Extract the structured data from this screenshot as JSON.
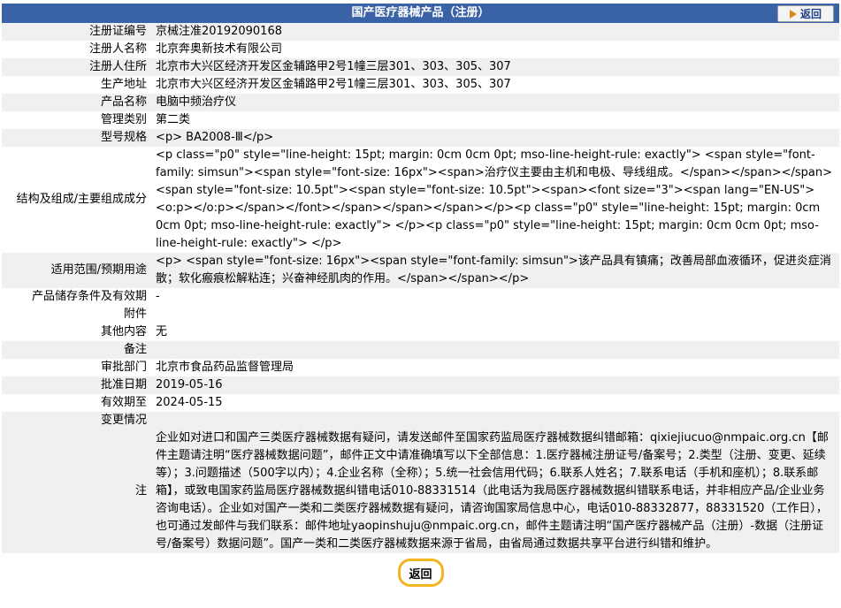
{
  "header": {
    "title": "国产医疗器械产品（注册）",
    "back_label": "返回"
  },
  "rows": [
    {
      "label": "注册证编号",
      "value": "京械注准20192090168"
    },
    {
      "label": "注册人名称",
      "value": "北京奔奥新技术有限公司"
    },
    {
      "label": "注册人住所",
      "value": "北京市大兴区经济开发区金辅路甲2号1幢三层301、303、305、307"
    },
    {
      "label": "生产地址",
      "value": "北京市大兴区经济开发区金辅路甲2号1幢三层301、303、305、307"
    },
    {
      "label": "产品名称",
      "value": "电脑中频治疗仪"
    },
    {
      "label": "管理类别",
      "value": "第二类"
    },
    {
      "label": "型号规格",
      "value": "<p> BA2008-Ⅲ</p>"
    },
    {
      "label": "结构及组成/主要组成成分",
      "value": "<p class=\"p0\" style=\"line-height: 15pt; margin: 0cm 0cm 0pt; mso-line-height-rule: exactly\"> <span style=\"font-family: simsun\"><span style=\"font-size: 16px\"><span>治疗仪主要由主机和电极、导线组成。</span></span></span><span style=\"font-size: 10.5pt\"><span style=\"font-size: 10.5pt\"><span><font size=\"3\"><span lang=\"EN-US\"><o:p></o:p></span></font></span></span></span></p><p class=\"p0\" style=\"line-height: 15pt; margin: 0cm 0cm 0pt; mso-line-height-rule: exactly\"> </p><p class=\"p0\" style=\"line-height: 15pt; margin: 0cm 0cm 0pt; mso-line-height-rule: exactly\"> </p>"
    },
    {
      "label": "适用范围/预期用途",
      "value": "<p> <span style=\"font-size: 16px\"><span style=\"font-family: simsun\">该产品具有镇痛；改善局部血液循环，促进炎症消散；软化瘢痕松解粘连；兴奋神经肌肉的作用。</span></span></p>"
    },
    {
      "label": "产品储存条件及有效期",
      "value": "-"
    },
    {
      "label": "附件",
      "value": ""
    },
    {
      "label": "其他内容",
      "value": "无"
    },
    {
      "label": "备注",
      "value": ""
    },
    {
      "label": "审批部门",
      "value": "北京市食品药品监督管理局"
    },
    {
      "label": "批准日期",
      "value": "2019-05-16"
    },
    {
      "label": "有效期至",
      "value": "2024-05-15"
    },
    {
      "label": "变更情况",
      "value": ""
    },
    {
      "label": "注",
      "value": "企业如对进口和国产三类医疗器械数据有疑问，请发送邮件至国家药监局医疗器械数据纠错邮箱：qixiejiucuo@nmpaic.org.cn【邮件主题请注明“医疗器械数据问题”，邮件正文中请准确填写以下全部信息：1.医疗器械注册证号/备案号；2.类型（注册、变更、延续等）；3.问题描述（500字以内）；4.企业名称（全称）；5.统一社会信用代码；6.联系人姓名；7.联系电话（手机和座机）；8.联系邮箱】，或致电国家药监局医疗器械数据纠错电话010-88331514（此电话为我局医疗器械数据纠错联系电话，并非相应产品/企业业务咨询电话）。企业如对国产一类和二类医疗器械数据有疑问，请咨询国家局信息中心，电话010-88332877，88331520（工作日），也可通过发邮件与我们联系：邮件地址yaopinshuju@nmpaic.org.cn，邮件主题请注明“国产医疗器械产品（注册）-数据（注册证号/备案号）数据问题”。国产一类和二类医疗器械数据来源于省局，由省局通过数据共享平台进行纠错和维护。"
    }
  ],
  "footer": {
    "back_label": "返回"
  }
}
